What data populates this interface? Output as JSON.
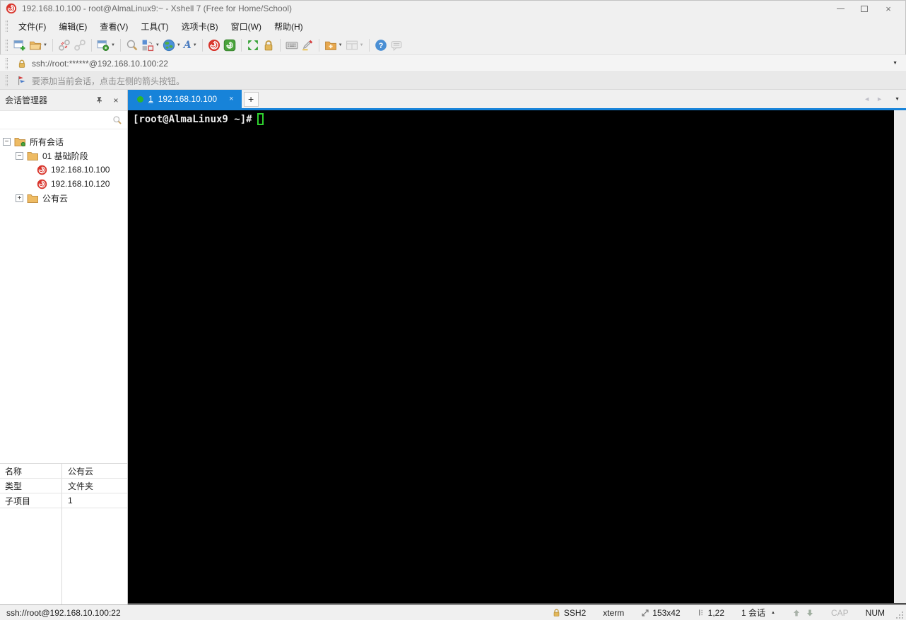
{
  "colors": {
    "accent_blue": "#1783d9",
    "tab_dot_green": "#2db52d",
    "cursor_green": "#2fd32f",
    "folder_gold": "#eebb63",
    "xshell_red": "#d8352c",
    "chrome_gray": "#f0f0f0",
    "terminal_bg": "#000000"
  },
  "window": {
    "title": "192.168.10.100 - root@AlmaLinux9:~ - Xshell 7 (Free for Home/School)"
  },
  "menu": {
    "items": [
      "文件(F)",
      "编辑(E)",
      "查看(V)",
      "工具(T)",
      "选项卡(B)",
      "窗口(W)",
      "帮助(H)"
    ]
  },
  "toolbar": {
    "icons": [
      "new-session",
      "open-folder",
      "disconnect",
      "reconnect",
      "session-properties",
      "find",
      "arrange-tabs",
      "encoding-globe",
      "font",
      "xshell",
      "xftp",
      "fullscreen",
      "lock-screen",
      "virtual-keyboard",
      "highlighter",
      "new-folder",
      "layout",
      "help",
      "feedback"
    ],
    "font_glyph": "A"
  },
  "address_bar": {
    "url": "ssh://root:******@192.168.10.100:22"
  },
  "info_bar": {
    "message": "要添加当前会话，点击左侧的箭头按钮。"
  },
  "session_manager": {
    "title": "会话管理器",
    "tree": [
      {
        "label": "所有会话",
        "expander": "−",
        "type": "root-folder"
      },
      {
        "label": "01 基础阶段",
        "expander": "−",
        "type": "folder"
      },
      {
        "label": "192.168.10.100",
        "type": "session"
      },
      {
        "label": "192.168.10.120",
        "type": "session"
      },
      {
        "label": "公有云",
        "expander": "+",
        "type": "folder"
      }
    ],
    "properties": {
      "rows": [
        {
          "key": "名称",
          "value": "公有云"
        },
        {
          "key": "类型",
          "value": "文件夹"
        },
        {
          "key": "子项目",
          "value": "1"
        }
      ]
    }
  },
  "tabs": {
    "active": {
      "index": "1",
      "label": "192.168.10.100"
    },
    "new_tab": "+"
  },
  "terminal": {
    "prompt": "[root@AlmaLinux9 ~]#"
  },
  "status_bar": {
    "url": "ssh://root@192.168.10.100:22",
    "protocol": "SSH2",
    "terminal_type": "xterm",
    "size": "153x42",
    "cursor_position": "1,22",
    "sessions": "1 会话",
    "cap": "CAP",
    "num": "NUM"
  },
  "glyphs": {
    "tab_close": "×",
    "panel_close": "×",
    "caret_down": "▼",
    "expander_session_root": "−",
    "nav_left": "◄",
    "nav_right": "►",
    "session_caret_up": "▲"
  }
}
